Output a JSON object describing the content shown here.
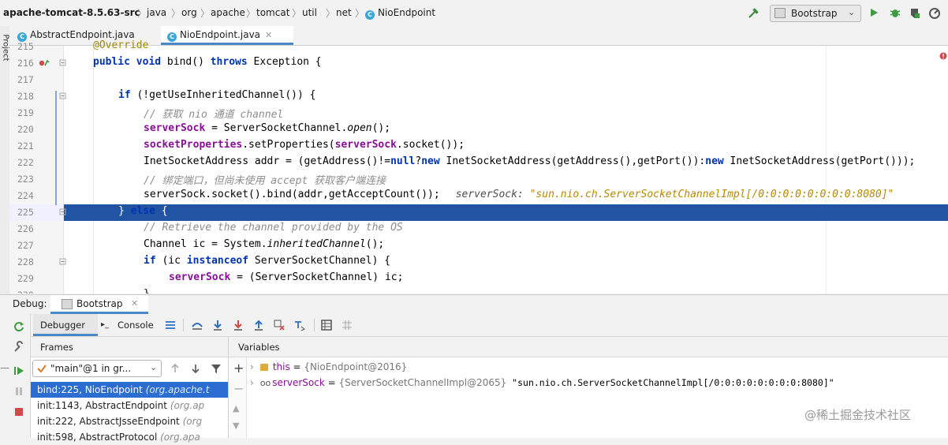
{
  "nav": {
    "crumbs": [
      "apache-tomcat-8.5.63-src",
      "java",
      "org",
      "apache",
      "tomcat",
      "util",
      "net",
      "NioEndpoint"
    ],
    "run_config": "Bootstrap"
  },
  "tabs": [
    {
      "label": "AbstractEndpoint.java",
      "active": false
    },
    {
      "label": "NioEndpoint.java",
      "active": true
    }
  ],
  "left_stripe_label": "Project",
  "editor": {
    "lines": [
      {
        "n": "215",
        "text": "@Override"
      },
      {
        "n": "216",
        "text": "public void bind() throws Exception {"
      },
      {
        "n": "217",
        "text": ""
      },
      {
        "n": "218",
        "text": "if (!getUseInheritedChannel()) {"
      },
      {
        "n": "219",
        "text": "// 获取 nio 通道 channel"
      },
      {
        "n": "220",
        "text": "serverSock = ServerSocketChannel.open();"
      },
      {
        "n": "221",
        "text": "socketProperties.setProperties(serverSock.socket());"
      },
      {
        "n": "222",
        "text": "InetSocketAddress addr = (getAddress()!=null?new InetSocketAddress(getAddress(),getPort()):new InetSocketAddress(getPort()));"
      },
      {
        "n": "223",
        "text": "// 绑定端口，但尚未使用 accept 获取客户端连接"
      },
      {
        "n": "224",
        "text": "serverSock.socket().bind(addr,getAcceptCount());"
      },
      {
        "n": "225",
        "text": "} else {"
      },
      {
        "n": "226",
        "text": "// Retrieve the channel provided by the OS"
      },
      {
        "n": "227",
        "text": "Channel ic = System.inheritedChannel();"
      },
      {
        "n": "228",
        "text": "if (ic instanceof ServerSocketChannel) {"
      },
      {
        "n": "229",
        "text": "serverSock = (ServerSocketChannel) ic;"
      },
      {
        "n": "230",
        "text": "}"
      }
    ],
    "inline_hint_name": "serverSock:",
    "inline_hint_value": "\"sun.nio.ch.ServerSocketChannelImpl[/0:0:0:0:0:0:0:0:8080]\""
  },
  "debug": {
    "label": "Debug:",
    "config_tab": "Bootstrap",
    "tabs": [
      "Debugger",
      "Console"
    ],
    "frames_title": "Frames",
    "variables_title": "Variables",
    "thread": "\"main\"@1 in gr...",
    "frames": [
      {
        "method": "bind:225, NioEndpoint",
        "loc": "(org.apache.t"
      },
      {
        "method": "init:1143, AbstractEndpoint",
        "loc": "(org.ap"
      },
      {
        "method": "init:222, AbstractJsseEndpoint",
        "loc": "(org"
      },
      {
        "method": "init:598, AbstractProtocol",
        "loc": "(org.apa"
      }
    ],
    "variables": [
      {
        "name": "this",
        "eq": " = ",
        "type": "{NioEndpoint@2016}",
        "value": ""
      },
      {
        "name": "serverSock",
        "eq": " = ",
        "type": "{ServerSocketChannelImpl@2065}",
        "value": " \"sun.nio.ch.ServerSocketChannelImpl[/0:0:0:0:0:0:0:0:8080]\""
      }
    ]
  },
  "watermark": "@稀土掘金技术社区",
  "colors": {
    "selection": "#2154a3",
    "accent": "#4a88c7",
    "keyword": "#0033b3",
    "field": "#871094"
  }
}
